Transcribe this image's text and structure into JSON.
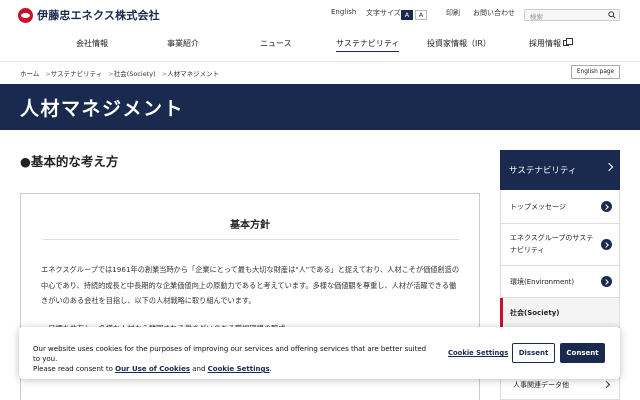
{
  "header": {
    "logo_text": "伊藤忠エネクス株式会社",
    "english_link": "English",
    "font_size_label": "文字サイズ",
    "font_size_options": [
      "A",
      "A"
    ],
    "print_link": "印刷",
    "contact_link": "お問い合わせ",
    "search_placeholder": "検索"
  },
  "nav": {
    "items": [
      "会社情報",
      "事業紹介",
      "ニュース",
      "サステナビリティ",
      "投資家情報（IR）",
      "採用情報"
    ],
    "active": "サステナビリティ"
  },
  "breadcrumb": [
    "ホーム",
    "サステナビリティ",
    "社会(Society)",
    "人材マネジメント"
  ],
  "english_page_button": "English page",
  "page_title": "人材マネジメント",
  "main": {
    "section_heading": "●基本的な考え方",
    "policy_title": "基本方針",
    "policy_body": "エネクスグループでは1961年の創業当時から「企業にとって最も大切な財産は\"人\"である」と捉えており、人材こそが価値創造の中心であり、持続的成長と中長期的な企業価値向上の原動力であると考えています。多様な価値観を尊重し、人材が活躍できる働きがいのある会社を目指し、以下の人材戦略に取り組んでいます。",
    "policy_bullet": "・目標を共有し、多様な人材から賛同される働きがいのある職場環境の醸成"
  },
  "sidebar": {
    "heading": "サステナビリティ",
    "items": [
      {
        "label": "トップメッセージ",
        "style": "circle"
      },
      {
        "label": "エネクスグループのサステナビリティ",
        "style": "circle"
      },
      {
        "label": "環境(Environment)",
        "style": "circle"
      },
      {
        "label": "社会(Society)",
        "style": "active"
      },
      {
        "label": "人事関連データ他",
        "style": "chevron"
      }
    ]
  },
  "cookie": {
    "text_line1": "Our website uses cookies for the purposes of improving our services and offering services that are better suited to you.",
    "text_prefix": "Please read consent to ",
    "link_use": "Our Use of Cookies",
    "text_and": " and ",
    "link_settings": "Cookie Settings",
    "text_suffix": ".",
    "settings_button": "Cookie Settings",
    "dissent_button": "Dissent",
    "consent_button": "Consent"
  },
  "colors": {
    "navy": "#1a2a4f",
    "brand_red": "#c8102e"
  }
}
